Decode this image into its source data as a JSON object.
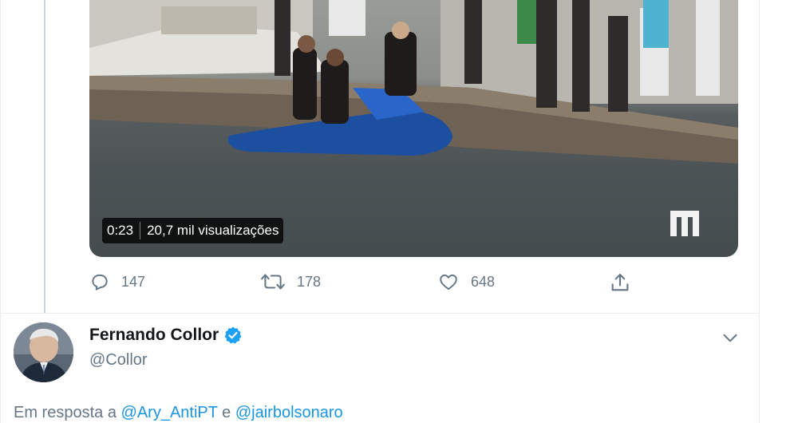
{
  "video": {
    "duration": "0:23",
    "views": "20,7 mil visualizações",
    "watermark_icon": "m-logo-icon"
  },
  "actions": {
    "reply_count": "147",
    "retweet_count": "178",
    "like_count": "648",
    "reply_icon": "reply-icon",
    "retweet_icon": "retweet-icon",
    "like_icon": "heart-icon",
    "share_icon": "share-icon"
  },
  "next_tweet": {
    "author_name": "Fernando Collor",
    "author_handle": "@Collor",
    "verified_icon": "verified-badge-icon",
    "more_icon": "chevron-down-icon",
    "reply_prefix": "Em resposta a",
    "reply_user_1": "@Ary_AntiPT",
    "reply_joiner": "e",
    "reply_user_2": "@jairbolsonaro"
  },
  "colors": {
    "accent": "#1b95e0",
    "muted_text": "#657786",
    "name_text": "#14171a",
    "border": "#e6ecf0",
    "verified": "#1da1f2"
  }
}
